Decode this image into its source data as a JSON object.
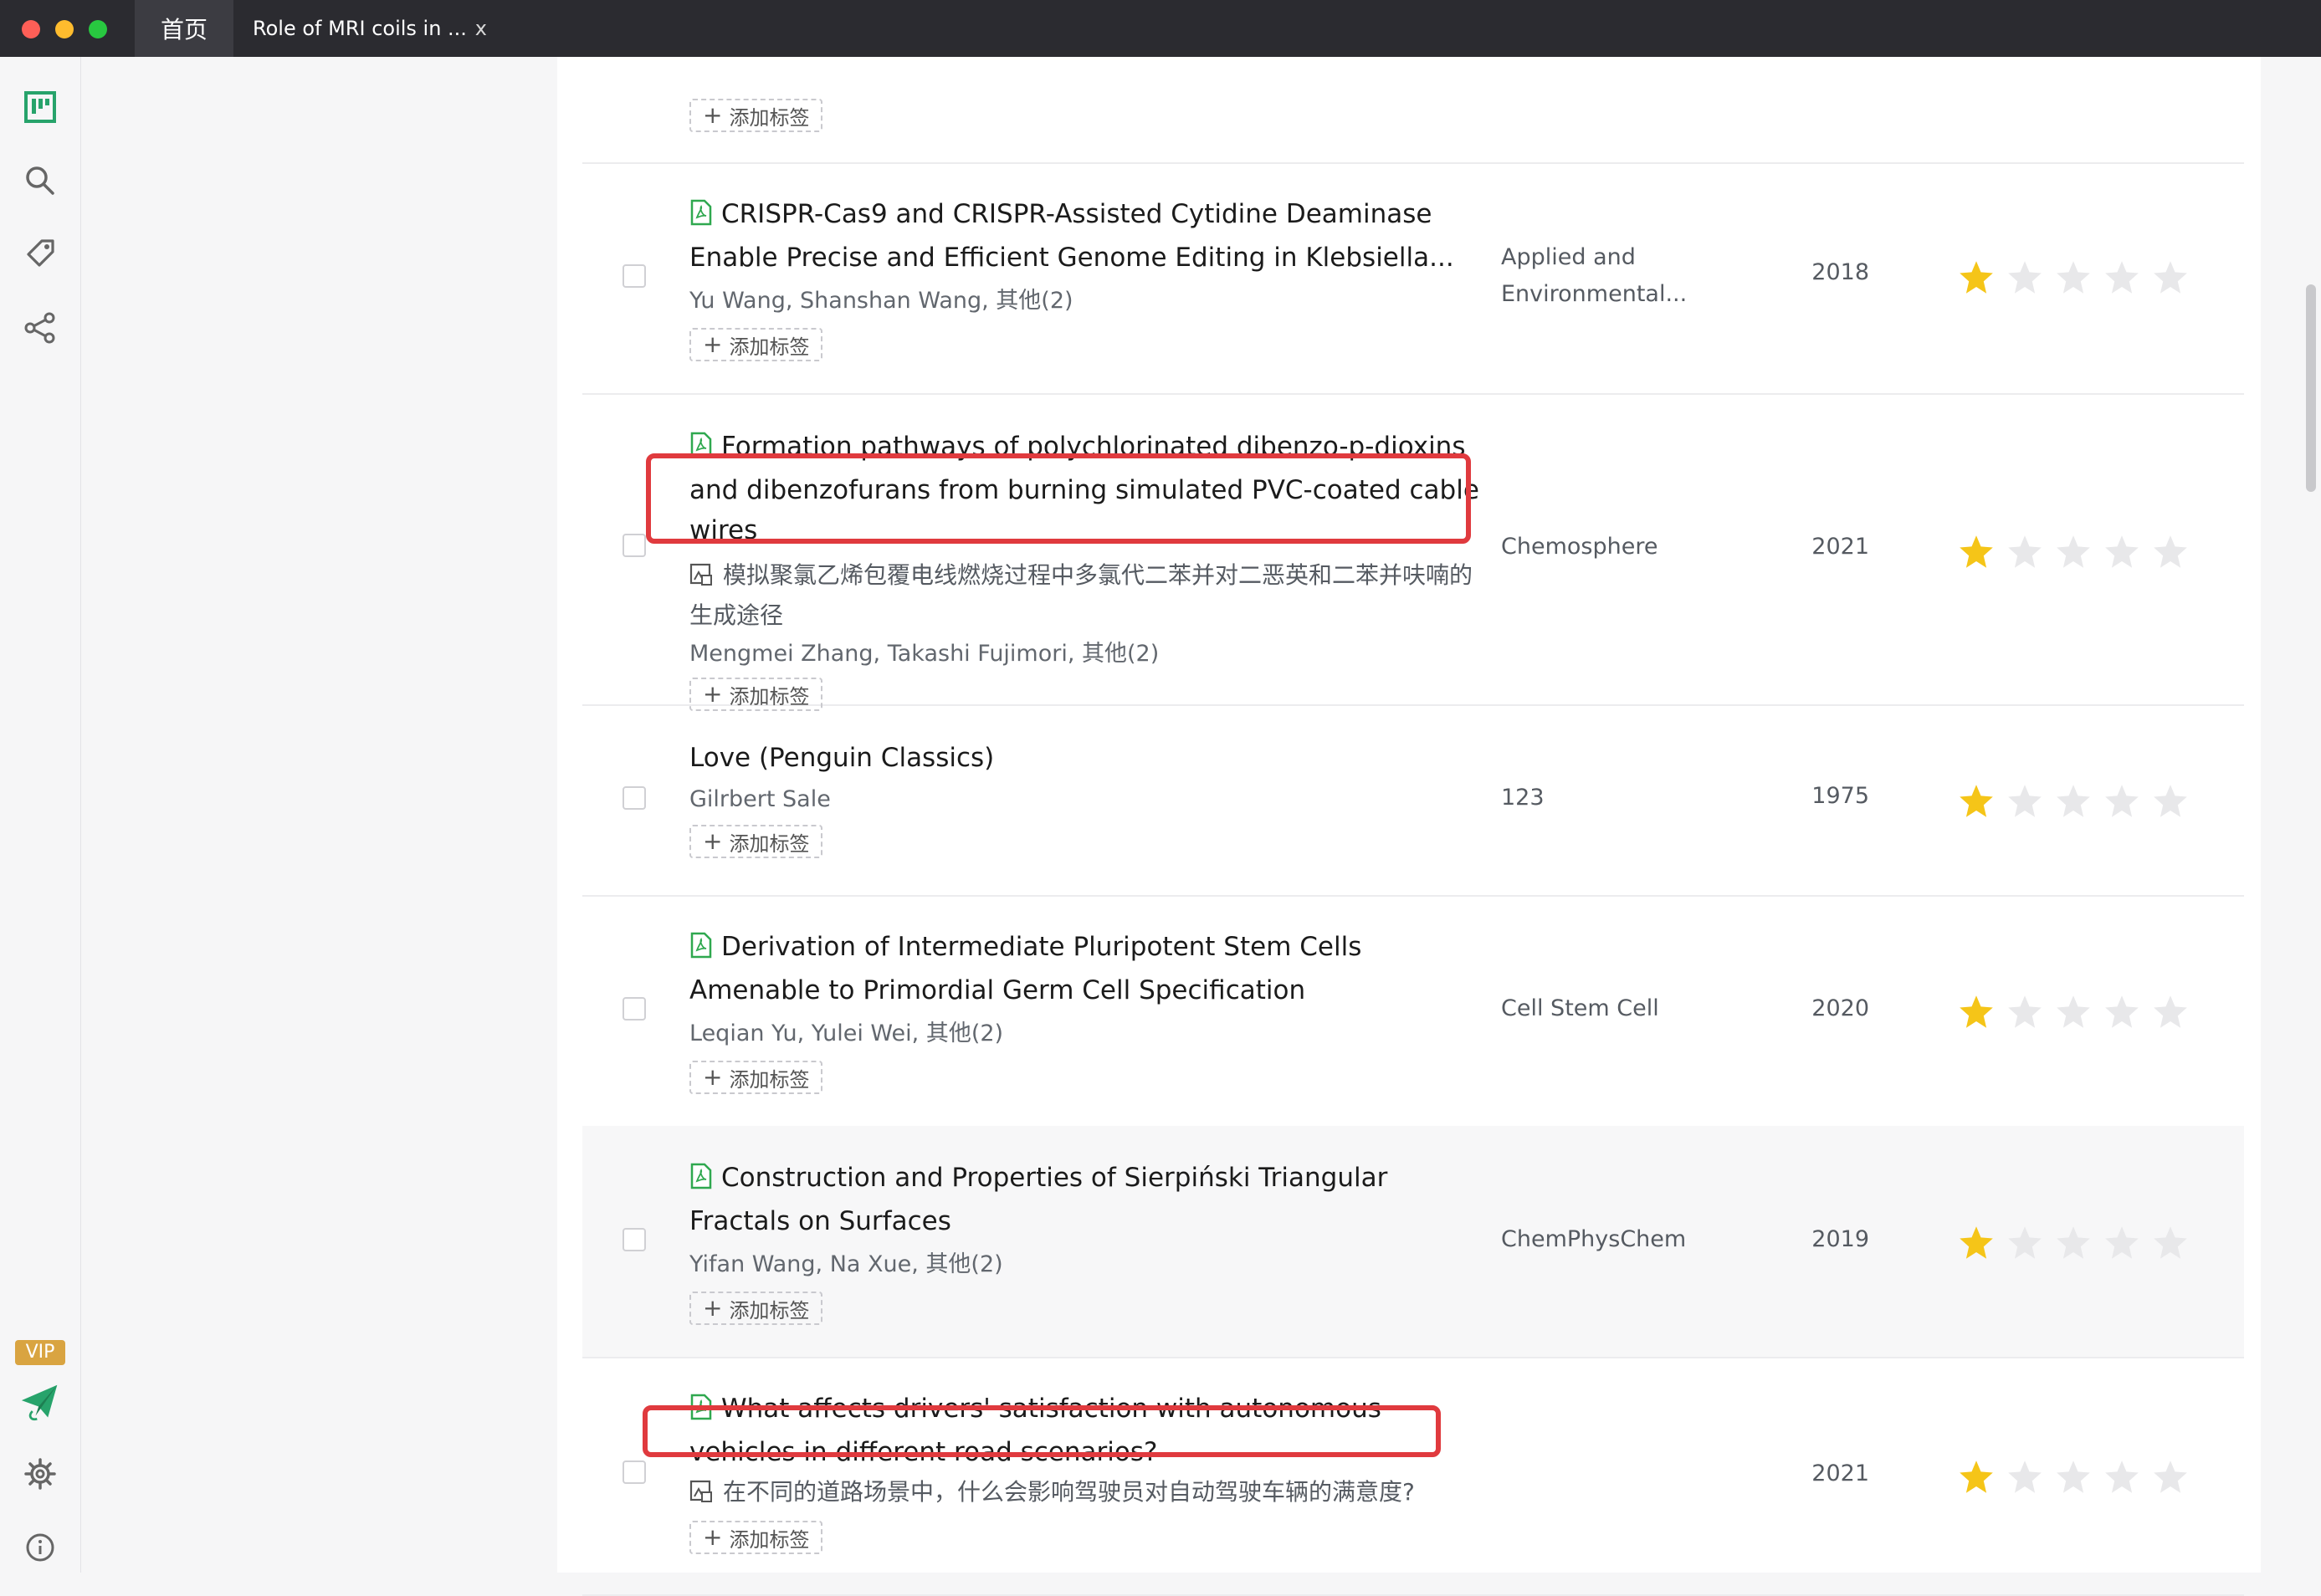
{
  "window": {
    "tabs": [
      {
        "label": "首页"
      },
      {
        "label": "Role of MRI coils in ...",
        "close": "x"
      }
    ]
  },
  "sidebar": {
    "icons": [
      "library-icon",
      "search-icon",
      "tag-icon",
      "share-icon"
    ],
    "vip_label": "VIP",
    "bottom_icons": [
      "paper-plane-icon",
      "gear-icon",
      "info-icon"
    ]
  },
  "papers": [
    {
      "title": "",
      "translation": "",
      "authors": "",
      "journal": "",
      "year": "",
      "rating": 0,
      "tag_label": "添加标签"
    },
    {
      "title": "CRISPR-Cas9 and CRISPR-Assisted Cytidine Deaminase Enable Precise and Efficient Genome Editing in Klebsiella...",
      "translation": "",
      "authors": "Yu Wang, Shanshan Wang, 其他(2)",
      "journal": "Applied and Environmental...",
      "year": "2018",
      "rating": 1,
      "tag_label": "添加标签"
    },
    {
      "title": "Formation pathways of polychlorinated dibenzo-p-dioxins and dibenzofurans from burning simulated PVC-coated cable wires",
      "translation": "模拟聚氯乙烯包覆电线燃烧过程中多氯代二苯并对二恶英和二苯并呋喃的生成途径",
      "authors": "Mengmei Zhang, Takashi Fujimori, 其他(2)",
      "journal": "Chemosphere",
      "year": "2021",
      "rating": 1,
      "tag_label": "添加标签"
    },
    {
      "title": "Love (Penguin Classics)",
      "translation": "",
      "authors": "Gilrbert Sale",
      "journal": "123",
      "year": "1975",
      "rating": 1,
      "tag_label": "添加标签"
    },
    {
      "title": "Derivation of Intermediate Pluripotent Stem Cells Amenable to Primordial Germ Cell Specification",
      "translation": "",
      "authors": "Leqian Yu, Yulei Wei, 其他(2)",
      "journal": "Cell Stem Cell",
      "year": "2020",
      "rating": 1,
      "tag_label": "添加标签"
    },
    {
      "title": "Construction and Properties of Sierpiński Triangular Fractals on Surfaces",
      "translation": "",
      "authors": "Yifan Wang, Na Xue, 其他(2)",
      "journal": "ChemPhysChem",
      "year": "2019",
      "rating": 1,
      "tag_label": "添加标签"
    },
    {
      "title": "What affects drivers' satisfaction with autonomous vehicles in different road scenarios?",
      "translation": "在不同的道路场景中，什么会影响驾驶员对自动驾驶车辆的满意度?",
      "authors": "",
      "journal": "",
      "year": "2021",
      "rating": 1,
      "tag_label": "添加标签"
    }
  ],
  "colors": {
    "accent_green": "#27a36b",
    "pdf_icon_green": "#2fa84f",
    "star_filled": "#f5c518",
    "star_empty": "#e8e8ea",
    "highlight_red": "#e03a3e",
    "vip_bg": "#d9a441"
  }
}
